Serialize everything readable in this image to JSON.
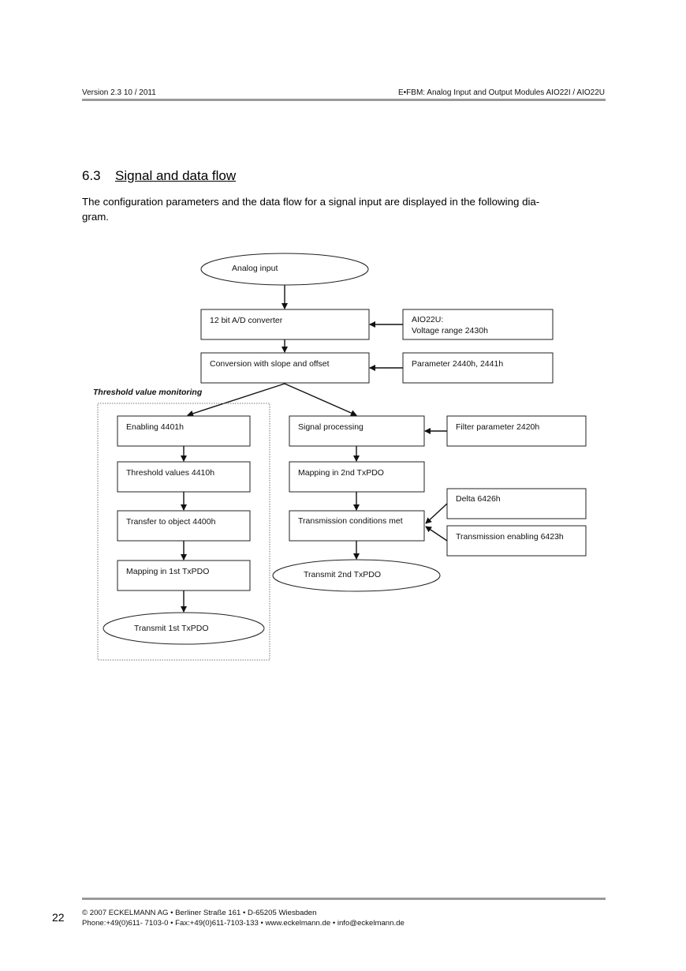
{
  "header": {
    "left": "Version 2.3  10 / 2011",
    "right": "E•FBM: Analog Input and Output Modules AIO22I / AIO22U"
  },
  "section": {
    "number": "6.3",
    "title": "Signal and data flow",
    "intro_line1": "The configuration parameters and the data flow for a signal input are displayed in the following dia-",
    "intro_line2": "gram."
  },
  "diagram": {
    "group_label": "Threshold value monitoring",
    "nodes": {
      "analog_input": "Analog input",
      "ad_converter": "12 bit A/D converter",
      "voltage_range_l1": "AIO22U:",
      "voltage_range_l2": "Voltage range 2430h",
      "conversion": "Conversion with slope and offset",
      "parameter": "Parameter 2440h, 2441h",
      "enabling": "Enabling 4401h",
      "threshold_values": "Threshold values 4410h",
      "transfer_object": "Transfer to object 4400h",
      "mapping_1st": "Mapping in 1st TxPDO",
      "transmit_1st": "Transmit 1st TxPDO",
      "signal_processing": "Signal processing",
      "filter_parameter": "Filter parameter 2420h",
      "mapping_2nd": "Mapping in 2nd TxPDO",
      "delta": "Delta 6426h",
      "transmission_conditions": "Transmission conditions met",
      "transmission_enabling": "Transmission enabling 6423h",
      "transmit_2nd": "Transmit 2nd TxPDO"
    }
  },
  "footer": {
    "page_number": "22",
    "line1": "©  2007 ECKELMANN AG • Berliner Straße 161 • D-65205 Wiesbaden",
    "line2": "Phone:+49(0)611- 7103-0 • Fax:+49(0)611-7103-133 • www.eckelmann.de • info@eckelmann.de"
  }
}
